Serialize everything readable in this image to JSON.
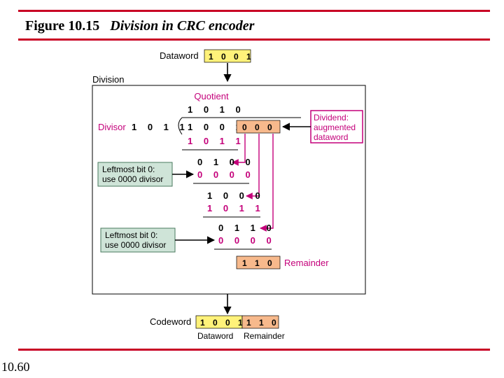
{
  "figure": {
    "number": "Figure 10.15",
    "desc": "Division in CRC encoder",
    "page_number": "10.60"
  },
  "colors": {
    "rule": "#c80024",
    "magenta": "#c4007a",
    "greenbox": "#cfe4d8",
    "peach": "#f7b98c",
    "yellow": "#fff27a"
  },
  "labels": {
    "dataword": "Dataword",
    "division": "Division",
    "quotient": "Quotient",
    "divisor": "Divisor",
    "dividend_note_1": "Dividend:",
    "dividend_note_2": "augmented",
    "dividend_note_3": "dataword",
    "left_note_1": "Leftmost bit 0:",
    "left_note_2": "use 0000 divisor",
    "remainder": "Remainder",
    "codeword": "Codeword",
    "codeword_dataword": "Dataword",
    "codeword_remainder": "Remainder"
  },
  "bits": {
    "dataword": "1 0 0 1",
    "quotient": "1 0 1 0",
    "divisor": "1 0 1 1",
    "dividend_base": "1 0 0 1",
    "dividend_aug": "0 0 0",
    "row2": "1 0 1 1",
    "row3": "0 1 0 0",
    "row4": "0 0 0 0",
    "row5": "1 0 0 0",
    "row6": "1 0 1 1",
    "row7": "0 1 1 0",
    "row8": "0 0 0 0",
    "remainder": "1 1 0",
    "codeword_data": "1 0 0 1",
    "codeword_rem": "1 1 0"
  },
  "chart_data": {
    "type": "table",
    "description": "CRC long division",
    "divisor": [
      1,
      0,
      1,
      1
    ],
    "dataword": [
      1,
      0,
      0,
      1
    ],
    "augmented_dividend": [
      1,
      0,
      0,
      1,
      0,
      0,
      0
    ],
    "quotient": [
      1,
      0,
      1,
      0
    ],
    "steps": [
      {
        "partial": [
          1,
          0,
          0,
          1
        ],
        "sub": [
          1,
          0,
          1,
          1
        ]
      },
      {
        "partial": [
          0,
          1,
          0,
          0
        ],
        "sub": [
          0,
          0,
          0,
          0
        ],
        "note": "Leftmost bit 0: use 0000 divisor"
      },
      {
        "partial": [
          1,
          0,
          0,
          0
        ],
        "sub": [
          1,
          0,
          1,
          1
        ]
      },
      {
        "partial": [
          0,
          1,
          1,
          0
        ],
        "sub": [
          0,
          0,
          0,
          0
        ],
        "note": "Leftmost bit 0: use 0000 divisor"
      }
    ],
    "remainder": [
      1,
      1,
      0
    ],
    "codeword": [
      1,
      0,
      0,
      1,
      1,
      1,
      0
    ]
  }
}
